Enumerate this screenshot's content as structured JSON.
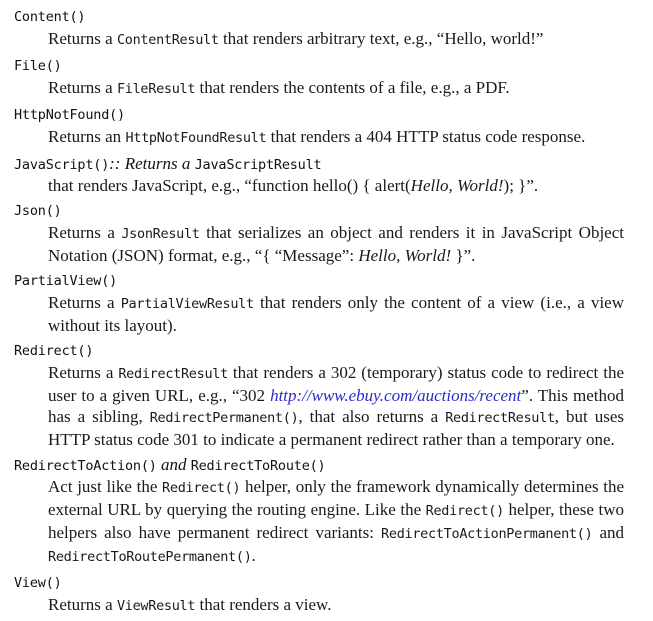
{
  "entries": [
    {
      "term": "Content()",
      "desc": [
        "Returns a ",
        {
          "code": "ContentResult"
        },
        " that renders arbitrary text, e.g., “Hello, world!”"
      ]
    },
    {
      "term": "File()",
      "desc": [
        "Returns a ",
        {
          "code": "FileResult"
        },
        " that renders the contents of a file, e.g., a PDF."
      ]
    },
    {
      "term": "HttpNotFound()",
      "desc": [
        "Returns an ",
        {
          "code": "HttpNotFoundResult"
        },
        " that renders a 404 HTTP status code response."
      ]
    },
    {
      "term": "JavaScript()",
      "term_suffix": [
        {
          "it": ":: Returns a "
        },
        {
          "code": "JavaScriptResult"
        }
      ],
      "desc": [
        "that renders JavaScript, e.g., “function hello() { alert(",
        {
          "it": "Hello, World!"
        },
        "); }”."
      ]
    },
    {
      "term": "Json()",
      "desc": [
        "Returns a ",
        {
          "code": "JsonResult"
        },
        " that serializes an object and renders it in JavaScript Object Notation (JSON) format, e.g., “{ “Message”: ",
        {
          "it": "Hello, World!"
        },
        " }”."
      ]
    },
    {
      "term": "PartialView()",
      "desc": [
        "Returns a ",
        {
          "code": "PartialViewResult"
        },
        " that renders only the content of a view (i.e., a view without its layout)."
      ]
    },
    {
      "term": "Redirect()",
      "desc": [
        "Returns a ",
        {
          "code": "RedirectResult"
        },
        " that renders a 302 (temporary) status code to redirect the user to a given URL, e.g., “302 ",
        {
          "link": "http://www.ebuy.com/auctions/recent"
        },
        "”. This method has a sibling, ",
        {
          "code": "RedirectPermanent()"
        },
        ", that also returns a ",
        {
          "code": "RedirectResult"
        },
        ", but uses HTTP status code 301 to indicate a permanent redirect rather than a tempo­rary one."
      ]
    },
    {
      "term": "RedirectToAction()",
      "term_suffix": [
        {
          "it": " and "
        },
        {
          "code": "RedirectToRoute()"
        }
      ],
      "desc": [
        "Act just like the ",
        {
          "code": "Redirect()"
        },
        " helper, only the framework dynamically determines the external URL by querying the routing engine. Like the ",
        {
          "code": "Redirect()"
        },
        " helper, these two helpers also have permanent redirect variants: ",
        {
          "code": "RedirectToActionPermanent()"
        },
        " and ",
        {
          "code": "RedirectToRoutePermanent()"
        },
        "."
      ]
    },
    {
      "term": "View()",
      "desc": [
        "Returns a ",
        {
          "code": "ViewResult"
        },
        " that renders a view."
      ]
    }
  ],
  "colors": {
    "text": "#1a1a1a",
    "link": "#2b2bc8"
  }
}
